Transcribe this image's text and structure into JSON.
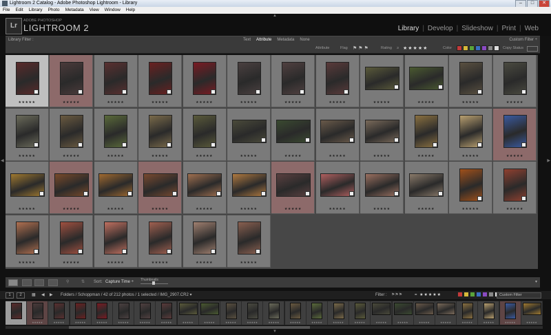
{
  "window": {
    "title": "Lightroom 2 Catalog - Adobe Photoshop Lightroom - Library",
    "min": "–",
    "max": "□",
    "close": "✕"
  },
  "menu": [
    "File",
    "Edit",
    "Library",
    "Photo",
    "Metadata",
    "View",
    "Window",
    "Help"
  ],
  "identity": {
    "logo": "Lr",
    "catalog": "ADOBE PHOTOSHOP",
    "brand": "LIGHTROOM 2"
  },
  "modules": [
    {
      "label": "Library",
      "active": true
    },
    {
      "label": "Develop",
      "active": false
    },
    {
      "label": "Slideshow",
      "active": false
    },
    {
      "label": "Print",
      "active": false
    },
    {
      "label": "Web",
      "active": false
    }
  ],
  "library_filter": {
    "label": "Library Filter :",
    "tabs": [
      {
        "label": "Text",
        "active": false
      },
      {
        "label": "Attribute",
        "active": true
      },
      {
        "label": "Metadata",
        "active": false
      },
      {
        "label": "None",
        "active": false
      }
    ],
    "custom": "Custom Filter ÷"
  },
  "attribute_bar": {
    "attribute": "Attribute",
    "flag": "Flag",
    "rating": "Rating",
    "rating_op": "≥",
    "stars": "★★★★★",
    "color": "Color",
    "copy_status": "Copy Status",
    "color_swatches": [
      "#c23a3a",
      "#d6b93a",
      "#5aa33a",
      "#3a6fc2",
      "#8a4ac2",
      "#888888",
      "#dddddd"
    ]
  },
  "grid": {
    "stars": "★★★★★",
    "cells": [
      {
        "o": "p",
        "c": "#5a2a2a",
        "s": "sel"
      },
      {
        "o": "p",
        "c": "#4a3a3a",
        "s": "pick"
      },
      {
        "o": "p",
        "c": "#5a3030",
        "s": ""
      },
      {
        "o": "p",
        "c": "#6a2020",
        "s": ""
      },
      {
        "o": "p",
        "c": "#7a1a22",
        "s": ""
      },
      {
        "o": "p",
        "c": "#4a4040",
        "s": ""
      },
      {
        "o": "p",
        "c": "#504040",
        "s": ""
      },
      {
        "o": "p",
        "c": "#5a3a3a",
        "s": ""
      },
      {
        "o": "l",
        "c": "#5a5a3a",
        "s": ""
      },
      {
        "o": "l",
        "c": "#4a5a30",
        "s": ""
      },
      {
        "o": "p",
        "c": "#5a5040",
        "s": ""
      },
      {
        "o": "p",
        "c": "#4a4a40",
        "s": ""
      },
      {
        "o": "p",
        "c": "#6a6a5a",
        "s": ""
      },
      {
        "o": "p",
        "c": "#6a5a40",
        "s": ""
      },
      {
        "o": "p",
        "c": "#5a6a3a",
        "s": ""
      },
      {
        "o": "p",
        "c": "#7a6a4a",
        "s": ""
      },
      {
        "o": "p",
        "c": "#5a5a3a",
        "s": ""
      },
      {
        "o": "l",
        "c": "#4a4a3a",
        "s": ""
      },
      {
        "o": "l",
        "c": "#3a4a30",
        "s": ""
      },
      {
        "o": "l",
        "c": "#6a5a4a",
        "s": ""
      },
      {
        "o": "l",
        "c": "#7a6a5a",
        "s": ""
      },
      {
        "o": "p",
        "c": "#8a7040",
        "s": ""
      },
      {
        "o": "p",
        "c": "#b9a070",
        "s": ""
      },
      {
        "o": "p",
        "c": "#3a5aa0",
        "s": "pick"
      },
      {
        "o": "l",
        "c": "#a07a30",
        "s": ""
      },
      {
        "o": "l",
        "c": "#7a4a2a",
        "s": "pick"
      },
      {
        "o": "l",
        "c": "#a06a30",
        "s": ""
      },
      {
        "o": "l",
        "c": "#7a4a30",
        "s": "pick"
      },
      {
        "o": "l",
        "c": "#a07050",
        "s": ""
      },
      {
        "o": "l",
        "c": "#b07a40",
        "s": ""
      },
      {
        "o": "l",
        "c": "#5a4040",
        "s": "pick"
      },
      {
        "o": "l",
        "c": "#b06060",
        "s": ""
      },
      {
        "o": "l",
        "c": "#9a7060",
        "s": ""
      },
      {
        "o": "l",
        "c": "#8a7a6a",
        "s": ""
      },
      {
        "o": "p",
        "c": "#a0501a",
        "s": ""
      },
      {
        "o": "p",
        "c": "#904030",
        "s": ""
      },
      {
        "o": "p",
        "c": "#b07050",
        "s": ""
      },
      {
        "o": "p",
        "c": "#a05040",
        "s": ""
      },
      {
        "o": "p",
        "c": "#c07060",
        "s": ""
      },
      {
        "o": "p",
        "c": "#a06050",
        "s": ""
      },
      {
        "o": "p",
        "c": "#a08070",
        "s": ""
      },
      {
        "o": "p",
        "c": "#8a6050",
        "s": ""
      }
    ]
  },
  "toolbar": {
    "sort_label": "Sort:",
    "sort_value": "Capture Time ÷",
    "thumbnails": "Thumbnails",
    "more": "▾"
  },
  "filmstrip_bar": {
    "page1": "1",
    "page2": "2",
    "path": "Folders / Schoppman / 42 of 212 photos / 1 selected / IMG_2907.CR2 ▾",
    "filter": "Filter :",
    "rank": "= ★★★★★",
    "custom": "Custom Filter"
  },
  "filmstrip": {
    "stars": "★★★★★",
    "cells": [
      {
        "o": "p",
        "c": "#5a2a2a",
        "s": "sel"
      },
      {
        "o": "p",
        "c": "#4a3a3a",
        "s": "pick"
      },
      {
        "o": "p",
        "c": "#5a3030",
        "s": ""
      },
      {
        "o": "p",
        "c": "#6a2020",
        "s": ""
      },
      {
        "o": "p",
        "c": "#7a1a22",
        "s": ""
      },
      {
        "o": "p",
        "c": "#4a4040",
        "s": ""
      },
      {
        "o": "p",
        "c": "#504040",
        "s": ""
      },
      {
        "o": "p",
        "c": "#5a3a3a",
        "s": ""
      },
      {
        "o": "l",
        "c": "#5a5a3a",
        "s": ""
      },
      {
        "o": "l",
        "c": "#4a5a30",
        "s": ""
      },
      {
        "o": "p",
        "c": "#5a5040",
        "s": ""
      },
      {
        "o": "p",
        "c": "#4a4a40",
        "s": ""
      },
      {
        "o": "p",
        "c": "#6a6a5a",
        "s": ""
      },
      {
        "o": "p",
        "c": "#6a5a40",
        "s": ""
      },
      {
        "o": "p",
        "c": "#5a6a3a",
        "s": ""
      },
      {
        "o": "p",
        "c": "#7a6a4a",
        "s": ""
      },
      {
        "o": "p",
        "c": "#5a5a3a",
        "s": ""
      },
      {
        "o": "l",
        "c": "#4a4a3a",
        "s": ""
      },
      {
        "o": "l",
        "c": "#3a4a30",
        "s": ""
      },
      {
        "o": "l",
        "c": "#6a5a4a",
        "s": ""
      },
      {
        "o": "l",
        "c": "#7a6a5a",
        "s": ""
      },
      {
        "o": "p",
        "c": "#8a7040",
        "s": ""
      },
      {
        "o": "p",
        "c": "#b9a070",
        "s": ""
      },
      {
        "o": "p",
        "c": "#3a5aa0",
        "s": "pick"
      },
      {
        "o": "l",
        "c": "#a07a30",
        "s": ""
      }
    ]
  }
}
